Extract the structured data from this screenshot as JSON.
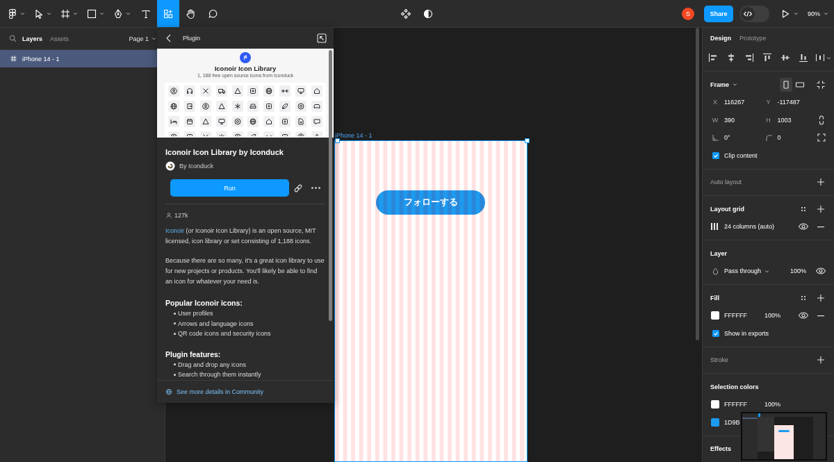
{
  "toolbar": {
    "tools": [
      {
        "kind": "main_menu",
        "selected": false
      },
      {
        "kind": "move",
        "selected": false
      },
      {
        "kind": "frame",
        "selected": false
      },
      {
        "kind": "shape",
        "selected": false
      },
      {
        "kind": "pen",
        "selected": false
      },
      {
        "kind": "text",
        "selected": false
      },
      {
        "kind": "resources",
        "selected": true
      },
      {
        "kind": "hand",
        "selected": false
      },
      {
        "kind": "comment",
        "selected": false
      }
    ],
    "avatar": "S",
    "share_button": "Share",
    "dev_mode": {
      "on": false
    },
    "zoom": "90%"
  },
  "left_panel": {
    "tabs": [
      {
        "label": "Layers",
        "selected": true
      },
      {
        "label": "Assets",
        "selected": false
      }
    ],
    "page": "Page 1",
    "layers": [
      {
        "name": "iPhone 14 - 1",
        "selected": true
      }
    ]
  },
  "plugin": {
    "header": "Plugin",
    "cover": {
      "title": "Iconoir Icon Library",
      "subtitle": "1, 188 free open source icons from Iconduck"
    },
    "title": "Iconoir Icon Library by Iconduck",
    "author": "By Iconduck",
    "run_button": "Run",
    "users": "127k",
    "description": [
      {
        "link": "Iconoir",
        "text": "(or Iconoir Icon Library) is an open source, MIT licensed, icon library or set consisting of 1,188 icons."
      },
      {
        "text": "Because there are so many, it's a great icon library to use for new projects or products. You'll likely be able to find an icon for whatever your need is."
      }
    ],
    "sections": [
      {
        "heading": "Popular Iconoir icons:",
        "items": [
          "User profiles",
          "Arrows and language icons",
          "QR code icons and security icons"
        ]
      },
      {
        "heading": "Plugin features:",
        "items": [
          "Drag and drop any icons",
          "Search through them instantly"
        ]
      }
    ],
    "footer_link": "See more details in Community"
  },
  "canvas": {
    "frame": {
      "name": "iPhone 14 - 1",
      "selected": true,
      "button": "フォローする"
    }
  },
  "design_panel": {
    "tabs": [
      {
        "label": "Design",
        "selected": true
      },
      {
        "label": "Prototype",
        "selected": false
      }
    ],
    "sections": [
      {
        "kind": "frame",
        "title": "Frame",
        "empty": false,
        "orientations": [
          {
            "kind": "portrait",
            "selected": true
          },
          {
            "kind": "landscape",
            "selected": false
          }
        ],
        "rows": [
          {
            "kind": "position",
            "fields": [
              {
                "label": "X",
                "value": "116267"
              },
              {
                "label": "Y",
                "value": "-117487"
              }
            ]
          },
          {
            "kind": "size",
            "fields": [
              {
                "label": "W",
                "value": "390"
              },
              {
                "label": "H",
                "value": "1003"
              }
            ]
          },
          {
            "kind": "angles",
            "fields": [
              {
                "value": "0°"
              },
              {
                "value": "0"
              }
            ]
          }
        ],
        "clip_content": {
          "label": "Clip content",
          "checked": true
        }
      },
      {
        "kind": "auto_layout",
        "title": "Auto layout",
        "empty": true
      },
      {
        "kind": "layout_grid",
        "title": "Layout grid",
        "empty": false,
        "grids": [
          {
            "label": "24 columns (auto)"
          }
        ]
      },
      {
        "kind": "layer",
        "title": "Layer",
        "empty": false,
        "blend": "Pass through",
        "opacity": "100%"
      },
      {
        "kind": "fill",
        "title": "Fill",
        "empty": false,
        "fills": [
          {
            "hex": "FFFFFF",
            "color": "#ffffff",
            "opacity": "100%"
          }
        ],
        "show_in_exports": {
          "label": "Show in exports",
          "checked": true
        }
      },
      {
        "kind": "stroke",
        "title": "Stroke",
        "empty": true
      },
      {
        "kind": "selection_colors",
        "title": "Selection colors",
        "empty": false,
        "colors": [
          {
            "hex": "FFFFFF",
            "color": "#ffffff",
            "opacity": "100%"
          },
          {
            "hex": "1D9B",
            "color": "#1d9bf0"
          }
        ]
      },
      {
        "kind": "effects",
        "title": "Effects",
        "empty": false
      }
    ]
  }
}
